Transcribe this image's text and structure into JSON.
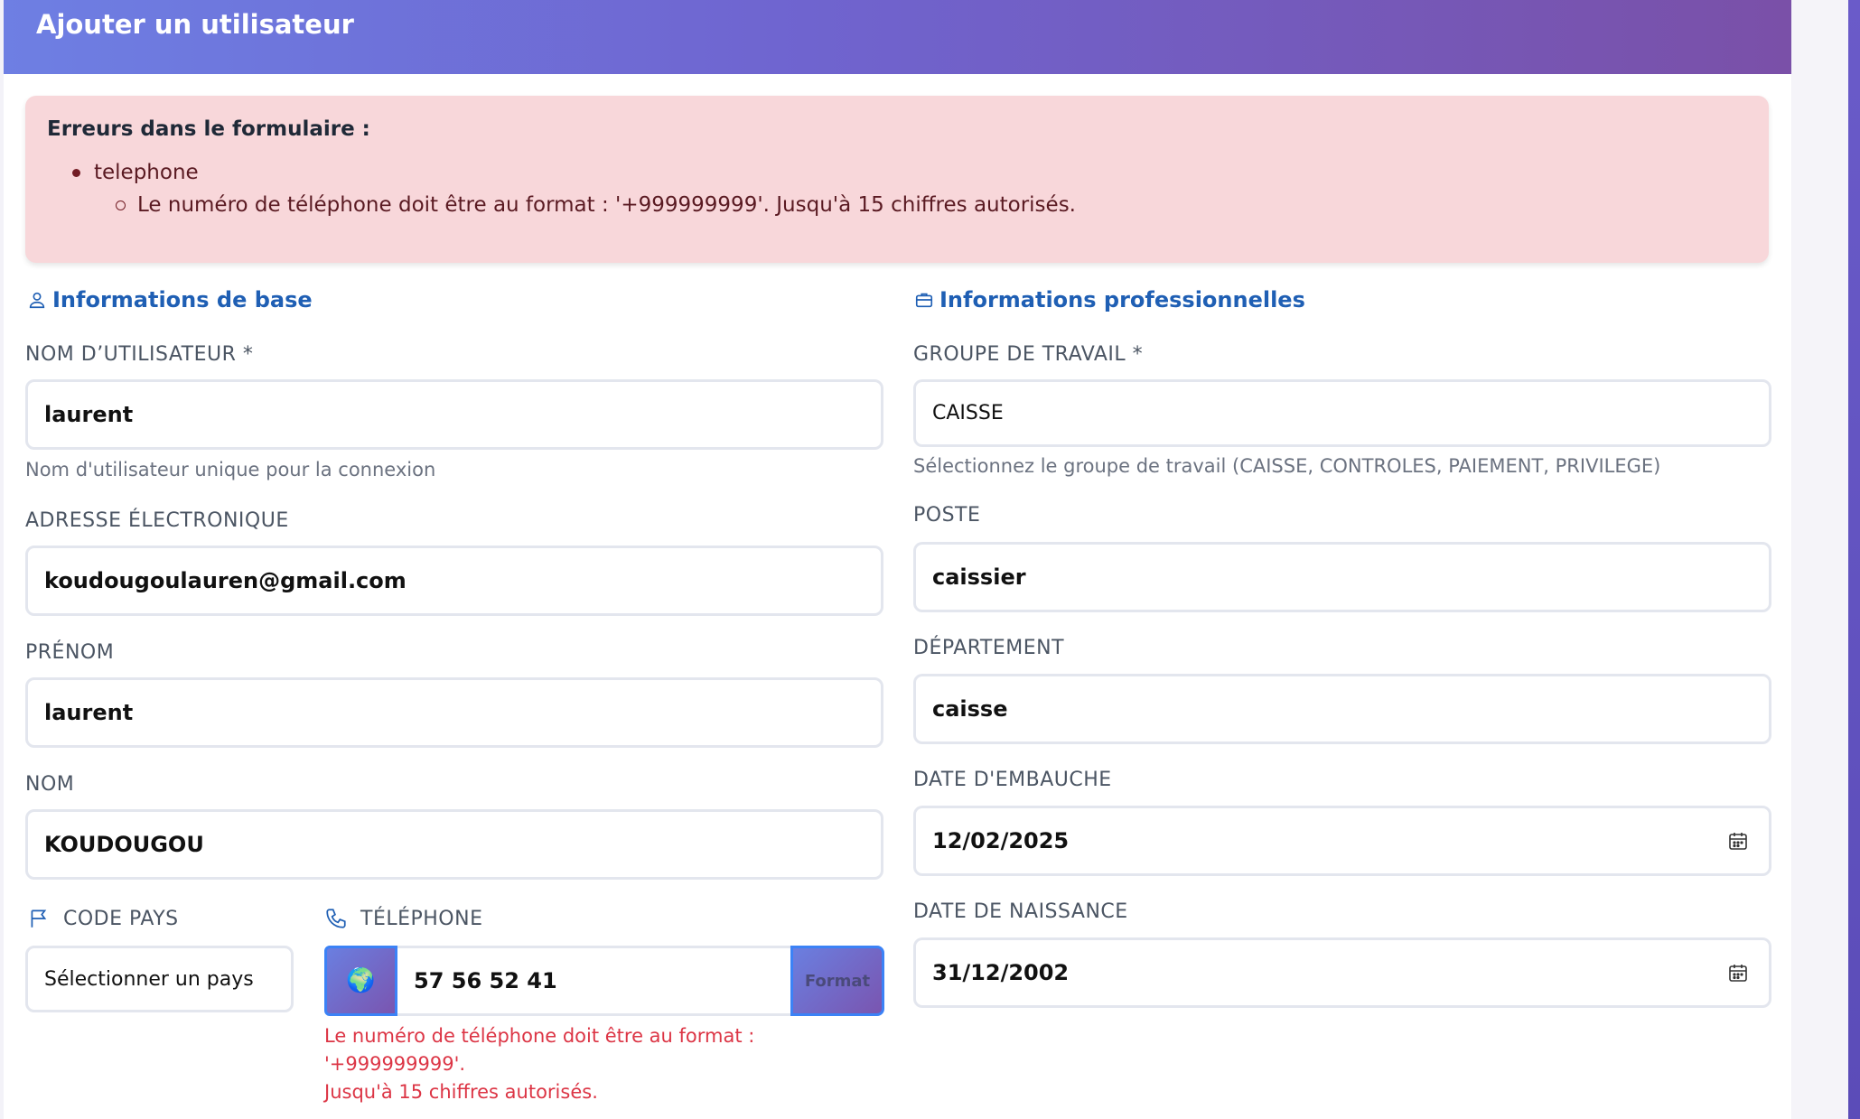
{
  "header": {
    "title": "Ajouter un utilisateur"
  },
  "alert": {
    "title": "Erreurs dans le formulaire :",
    "field": "telephone",
    "message": "Le numéro de téléphone doit être au format : '+999999999'. Jusqu'à 15 chiffres autorisés."
  },
  "base": {
    "section_title": "Informations de base",
    "username": {
      "label": "NOM D’UTILISATEUR *",
      "value": "laurent",
      "help": "Nom d'utilisateur unique pour la connexion"
    },
    "email": {
      "label": "ADRESSE ÉLECTRONIQUE",
      "value": "koudougoulauren@gmail.com"
    },
    "first_name": {
      "label": "PRÉNOM",
      "value": "laurent"
    },
    "last_name": {
      "label": "NOM",
      "value": "KOUDOUGOU"
    },
    "country_code": {
      "label": "CODE PAYS",
      "value": "Sélectionner un pays"
    },
    "phone": {
      "label": "TÉLÉPHONE",
      "flag": "🌍",
      "value": "57 56 52 41",
      "format_button": "Format",
      "error_line1": "Le numéro de téléphone doit être au format : '+999999999'.",
      "error_line2": "Jusqu'à 15 chiffres autorisés."
    }
  },
  "professional": {
    "section_title": "Informations professionnelles",
    "work_group": {
      "label": "GROUPE DE TRAVAIL *",
      "value": "CAISSE",
      "help": "Sélectionnez le groupe de travail (CAISSE, CONTROLES, PAIEMENT, PRIVILEGE)"
    },
    "position": {
      "label": "POSTE",
      "value": "caissier"
    },
    "department": {
      "label": "DÉPARTEMENT",
      "value": "caisse"
    },
    "hire_date": {
      "label": "DATE D'EMBAUCHE",
      "value": "12/02/2025"
    },
    "birth_date": {
      "label": "DATE DE NAISSANCE",
      "value": "31/12/2002"
    }
  },
  "colors": {
    "header_gradient_start": "#6e7fe3",
    "header_gradient_end": "#7a50a8",
    "alert_bg": "#f8d7da",
    "section_title": "#1f5fb4",
    "error": "#dc3545"
  }
}
